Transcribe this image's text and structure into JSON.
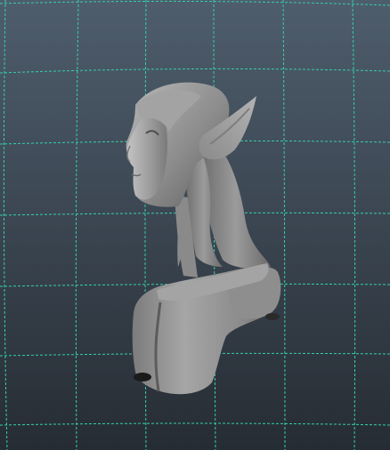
{
  "viewport": {
    "type": "3d-perspective-viewport",
    "background_top": "#4e5d6c",
    "background_bottom": "#262c33",
    "grid_color": "#35d0a6",
    "grid_style": "dashed",
    "model_color": "#8f8f8f",
    "model_highlight": "#b5b5b5",
    "model_shadow": "#5a5a5a"
  },
  "model": {
    "icon": "elf-bust-icon",
    "shading": "smooth-shaded"
  }
}
